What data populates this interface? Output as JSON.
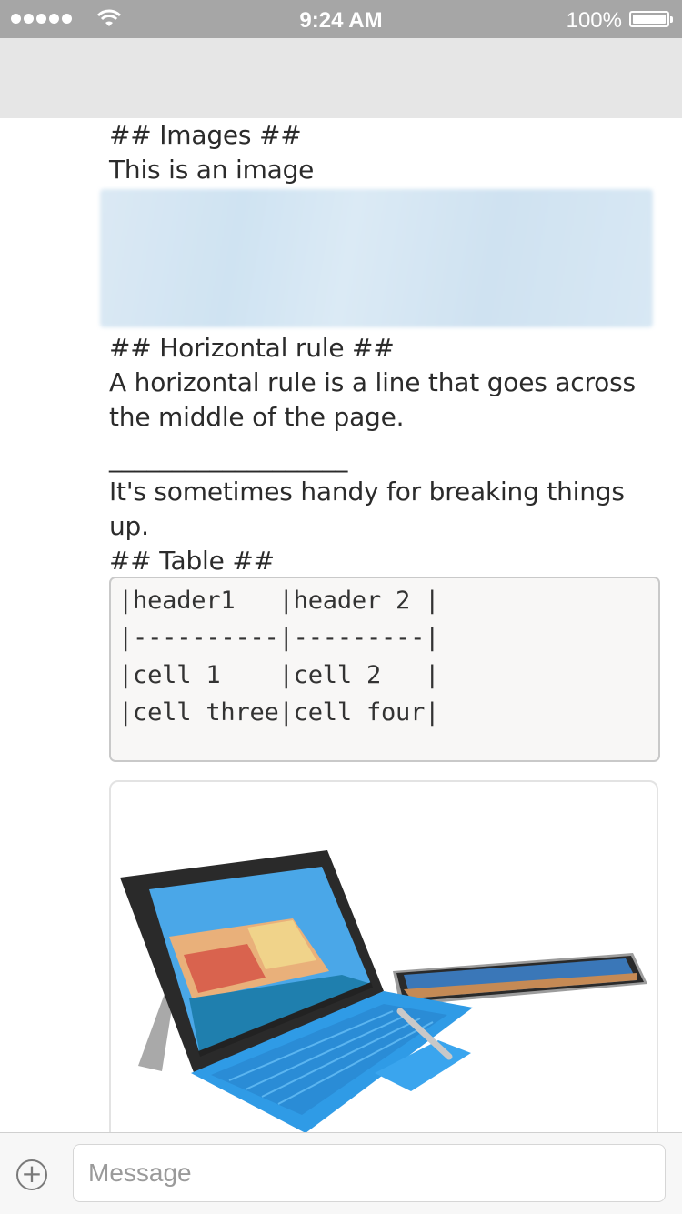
{
  "status_bar": {
    "time": "9:24 AM",
    "battery_percent": "100%",
    "signal_icon": "signal-dots-icon",
    "wifi_icon": "wifi-icon",
    "battery_icon": "battery-icon",
    "battery_level": 1.0
  },
  "message": {
    "lines": {
      "images_heading": "## Images ##",
      "image_text": "This is an image",
      "hr_heading": "## Horizontal rule ##",
      "hr_text": "A horizontal rule is a line that goes across the middle of the page.",
      "hr_rule": "___________________",
      "hr_after": "It's sometimes handy for breaking things up.",
      "table_heading": "## Table ##"
    },
    "code_block": {
      "lines": [
        "|header1   |header 2 |",
        "|----------|---------|",
        "|cell 1    |cell 2   |",
        "|cell three|cell four|"
      ]
    },
    "attachment": {
      "icon": "laptop-tablet-photo"
    }
  },
  "composer": {
    "add_icon": "plus-circle-icon",
    "placeholder": "Message"
  },
  "colors": {
    "status_bar": "#a6a6a6",
    "nav_bar": "#e6e6e6",
    "keyboard_blue": "#2f9be6"
  }
}
